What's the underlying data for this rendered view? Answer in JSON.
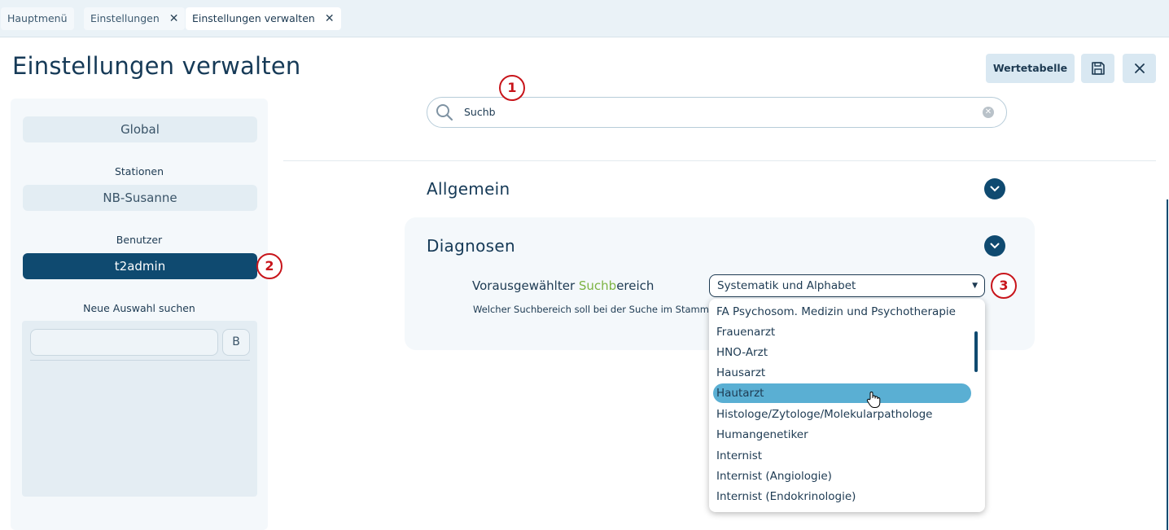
{
  "tabs": [
    {
      "label": "Hauptmenü",
      "closable": false,
      "active": false
    },
    {
      "label": "Einstellungen",
      "closable": true,
      "active": false
    },
    {
      "label": "Einstellungen verwalten",
      "closable": true,
      "active": true
    }
  ],
  "header": {
    "title": "Einstellungen verwalten",
    "wertetabelle_label": "Wertetabelle",
    "save_icon": "save-icon",
    "close_icon": "close-icon"
  },
  "sidebar": {
    "global_label": "Global",
    "stationen_heading": "Stationen",
    "station_item": "NB-Susanne",
    "benutzer_heading": "Benutzer",
    "user_item": "t2admin",
    "neue_auswahl_heading": "Neue Auswahl suchen",
    "search_value": "",
    "search_button_label": "B"
  },
  "search": {
    "value": "Suchb",
    "icon": "search-icon",
    "clear_icon": "clear-icon"
  },
  "sections": {
    "allgemein_title": "Allgemein",
    "diagnosen_title": "Diagnosen"
  },
  "setting": {
    "label_before": "Vorausgewählter ",
    "label_highlight": "Suchb",
    "label_after": "ereich",
    "description": "Welcher Suchbereich soll bei der Suche im Stamm v",
    "selected_value": "Systematik und Alphabet",
    "highlight_color": "#7cb342"
  },
  "dropdown": {
    "options": [
      "FA Psychosom. Medizin und Psychotherapie",
      "Frauenarzt",
      "HNO-Arzt",
      "Hausarzt",
      "Hautarzt",
      "Histologe/Zytologe/Molekularpathologe",
      "Humangenetiker",
      "Internist",
      "Internist (Angiologie)",
      "Internist (Endokrinologie)"
    ],
    "hovered_option": "Hautarzt"
  },
  "callouts": [
    "1",
    "2",
    "3"
  ],
  "colors": {
    "primary": "#0f4a70",
    "hover": "#5aafd3",
    "callout": "#c8151b"
  }
}
